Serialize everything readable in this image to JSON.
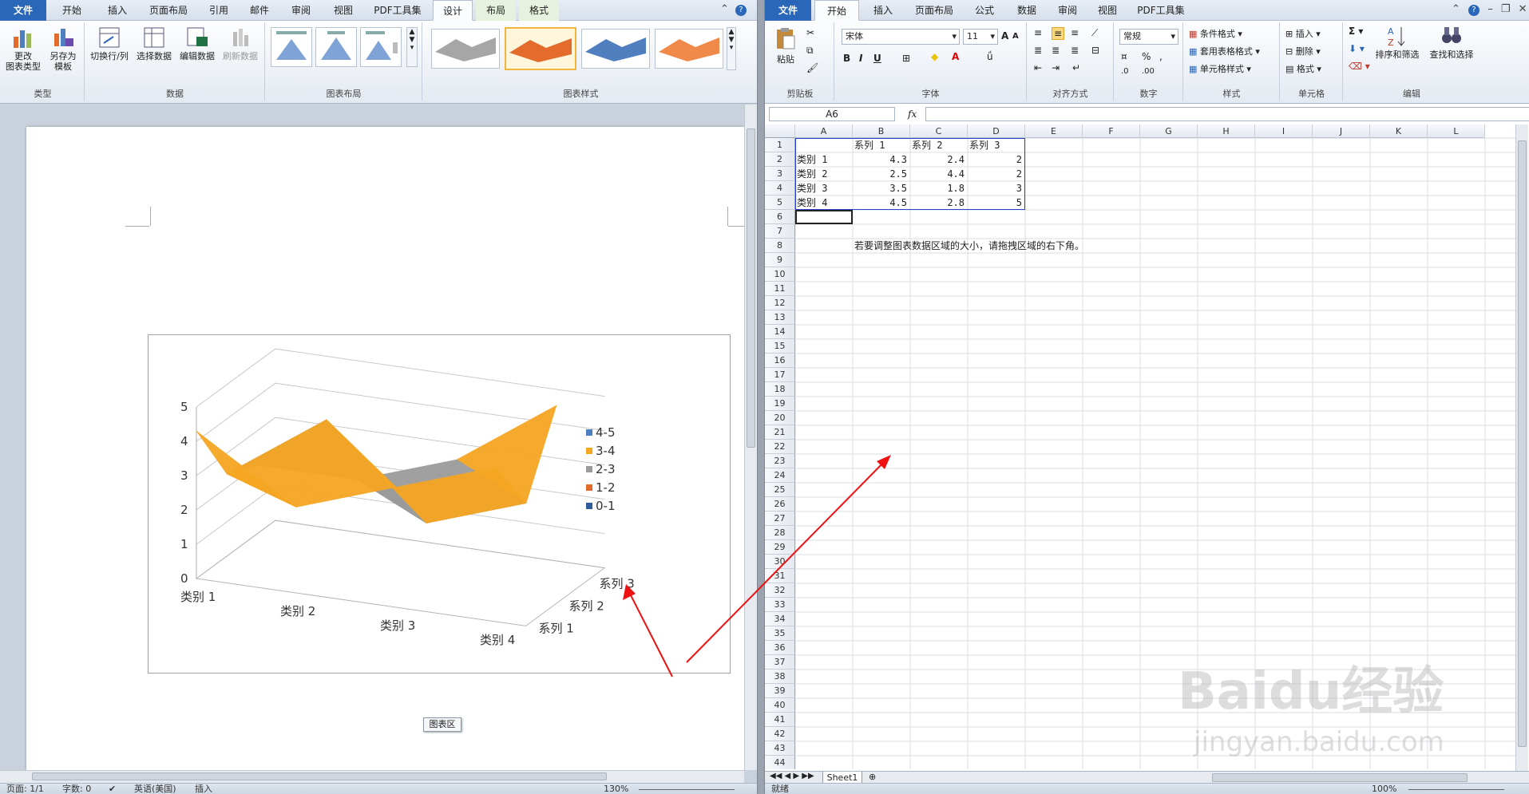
{
  "word": {
    "tabs": [
      {
        "label": "文件",
        "kind": "file"
      },
      {
        "label": "开始"
      },
      {
        "label": "插入"
      },
      {
        "label": "页面布局"
      },
      {
        "label": "引用"
      },
      {
        "label": "邮件"
      },
      {
        "label": "审阅"
      },
      {
        "label": "视图"
      },
      {
        "label": "PDF工具集"
      },
      {
        "label": "设计",
        "kind": "ctx",
        "active": true
      },
      {
        "label": "布局",
        "kind": "ctx"
      },
      {
        "label": "格式",
        "kind": "ctx"
      }
    ],
    "groups": {
      "type": {
        "label": "类型",
        "buttons": [
          {
            "label": "更改\n图表类型",
            "icon": "chart-type-icon"
          },
          {
            "label": "另存为\n模板",
            "icon": "save-template-icon"
          }
        ]
      },
      "data": {
        "label": "数据",
        "buttons": [
          {
            "label": "切换行/列",
            "icon": "switch-row-col-icon"
          },
          {
            "label": "选择数据",
            "icon": "select-data-icon"
          },
          {
            "label": "编辑数据",
            "icon": "edit-data-icon"
          },
          {
            "label": "刷新数据",
            "icon": "refresh-data-icon",
            "disabled": true
          }
        ]
      },
      "layout": {
        "label": "图表布局"
      },
      "styles": {
        "label": "图表样式"
      }
    },
    "chart_tag": "图表区",
    "status": {
      "page": "页面: 1/1",
      "words": "字数: 0",
      "language": "英语(美国)",
      "mode": "插入",
      "zoom": "130%"
    }
  },
  "excel": {
    "tabs": [
      {
        "label": "文件",
        "kind": "file"
      },
      {
        "label": "开始",
        "active": true
      },
      {
        "label": "插入"
      },
      {
        "label": "页面布局"
      },
      {
        "label": "公式"
      },
      {
        "label": "数据"
      },
      {
        "label": "审阅"
      },
      {
        "label": "视图"
      },
      {
        "label": "PDF工具集"
      }
    ],
    "clipboard": {
      "label": "剪贴板",
      "paste": "粘贴"
    },
    "font": {
      "label": "字体",
      "name": "宋体",
      "size": "11"
    },
    "align": {
      "label": "对齐方式"
    },
    "number": {
      "label": "数字",
      "format": "常规"
    },
    "styles": {
      "label": "样式",
      "items": [
        "条件格式",
        "套用表格格式",
        "单元格样式"
      ]
    },
    "cells": {
      "label": "单元格",
      "items": [
        "插入",
        "删除",
        "格式"
      ]
    },
    "edit": {
      "label": "编辑",
      "sort": "排序和筛选",
      "find": "查找和选择"
    },
    "name_box": "A6",
    "fx": "fx",
    "columns": [
      "A",
      "B",
      "C",
      "D",
      "E",
      "F",
      "G",
      "H",
      "I",
      "J",
      "K",
      "L"
    ],
    "rows": 44,
    "table": {
      "headers": [
        "",
        "系列 1",
        "系列 2",
        "系列 3"
      ],
      "rows": [
        [
          "类别 1",
          "4.3",
          "2.4",
          "2"
        ],
        [
          "类别 2",
          "2.5",
          "4.4",
          "2"
        ],
        [
          "类别 3",
          "3.5",
          "1.8",
          "3"
        ],
        [
          "类别 4",
          "4.5",
          "2.8",
          "5"
        ]
      ]
    },
    "note": "若要调整图表数据区域的大小，请拖拽区域的右下角。",
    "sheet": "Sheet1",
    "status": {
      "ready": "就绪",
      "zoom": "100%"
    }
  },
  "chart_data": {
    "type": "surface",
    "categories": [
      "类别 1",
      "类别 2",
      "类别 3",
      "类别 4"
    ],
    "series": [
      {
        "name": "系列 1",
        "values": [
          4.3,
          2.5,
          3.5,
          4.5
        ]
      },
      {
        "name": "系列 2",
        "values": [
          2.4,
          4.4,
          1.8,
          2.8
        ]
      },
      {
        "name": "系列 3",
        "values": [
          2,
          2,
          3,
          5
        ]
      }
    ],
    "ylim": [
      0,
      5
    ],
    "yticks": [
      "0",
      "1",
      "2",
      "3",
      "4",
      "5"
    ],
    "legend": {
      "placement": "right",
      "entries": [
        {
          "label": "4-5",
          "color": "#4f7fbf"
        },
        {
          "label": "3-4",
          "color": "#f5a623"
        },
        {
          "label": "2-3",
          "color": "#9b9b9b"
        },
        {
          "label": "1-2",
          "color": "#e36c2d"
        },
        {
          "label": "0-1",
          "color": "#2f5b9a"
        }
      ]
    },
    "band_colors": [
      "#2f5b9a",
      "#e36c2d",
      "#9b9b9b",
      "#f5a623",
      "#4f7fbf"
    ]
  },
  "watermark": {
    "logo_text": "Baidu经验",
    "url": "jingyan.baidu.com"
  }
}
